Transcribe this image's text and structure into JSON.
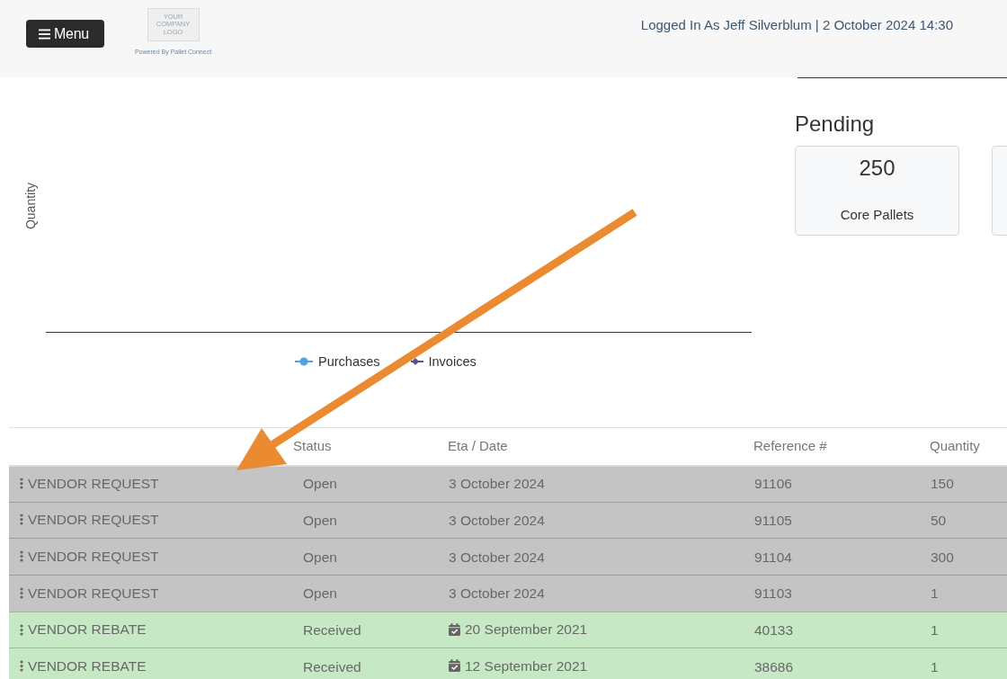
{
  "header": {
    "menu_button": "Menu",
    "logo_lines": [
      "YOUR",
      "COMPANY",
      "LOGO"
    ],
    "powered_by": "Powered By Pallet Connect",
    "user_info": "Logged In As Jeff Silverblum | 2 October 2024 14:30"
  },
  "chart": {
    "ylabel": "Quantity",
    "legend": [
      {
        "name": "Purchases",
        "kind": "circle",
        "color": "#4aa5e0"
      },
      {
        "name": "Invoices",
        "kind": "diamond",
        "color": "#5a4f8c"
      }
    ]
  },
  "pending": {
    "title": "Pending",
    "cards": [
      {
        "value": "250",
        "label": "Core Pallets"
      }
    ],
    "next_card_partly_visible": true
  },
  "table": {
    "columns": [
      "Status",
      "Eta / Date",
      "Reference #",
      "Quantity"
    ],
    "rows": [
      {
        "column_1": "VENDOR REQUEST",
        "status": "Open",
        "date": "3 October 2024",
        "calendar": false,
        "reference": "91106",
        "quantity": "150",
        "color": "#c4c4c4"
      },
      {
        "column_1": "VENDOR REQUEST",
        "status": "Open",
        "date": "3 October 2024",
        "calendar": false,
        "reference": "91105",
        "quantity": "50",
        "color": "#c4c4c4"
      },
      {
        "column_1": "VENDOR REQUEST",
        "status": "Open",
        "date": "3 October 2024",
        "calendar": false,
        "reference": "91104",
        "quantity": "300",
        "color": "#c4c4c4"
      },
      {
        "column_1": "VENDOR REQUEST",
        "status": "Open",
        "date": "3 October 2024",
        "calendar": false,
        "reference": "91103",
        "quantity": "1",
        "color": "#c4c4c4"
      },
      {
        "column_1": "VENDOR REBATE",
        "status": "Received",
        "date": "20 September 2021",
        "calendar": true,
        "reference": "40133",
        "quantity": "1",
        "color": "#c6e8c4"
      },
      {
        "column_1": "VENDOR REBATE",
        "status": "Received",
        "date": "12 September 2021",
        "calendar": true,
        "reference": "38686",
        "quantity": "1",
        "color": "#c6e8c4"
      }
    ]
  }
}
